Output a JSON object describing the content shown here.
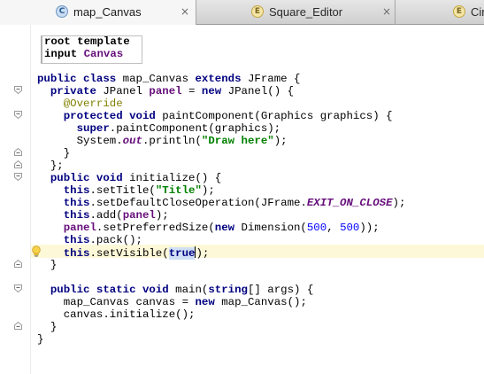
{
  "tabs": [
    {
      "icon": "C",
      "label": "map_Canvas",
      "close": "×",
      "active": true
    },
    {
      "icon": "E",
      "label": "Square_Editor",
      "close": "×",
      "active": false
    },
    {
      "icon": "E",
      "label": "Circ",
      "close": "",
      "active": false
    }
  ],
  "template": {
    "line1_a": "root",
    "line1_b": " template",
    "line2_a": "input",
    "line2_b": " Canvas"
  },
  "code": {
    "l1": {
      "a": "public class",
      "b": " map_Canvas ",
      "c": "extends",
      "d": " JFrame {"
    },
    "l2": {
      "a": "  private",
      "b": " JPanel ",
      "c": "panel",
      "d": " = ",
      "e": "new",
      "f": " JPanel() {"
    },
    "l3": {
      "a": "    @Override"
    },
    "l4": {
      "a": "    protected void",
      "b": " paintComponent(Graphics graphics) {"
    },
    "l5": {
      "a": "      super",
      "b": ".paintComponent(graphics);"
    },
    "l6": {
      "a": "      System.",
      "b": "out",
      "c": ".println(",
      "d": "\"Draw here\"",
      "e": ");"
    },
    "l7": {
      "a": "    }"
    },
    "l8": {
      "a": "  };"
    },
    "l9": {
      "a": "  public void",
      "b": " initialize() {"
    },
    "l10": {
      "a": "    this",
      "b": ".setTitle(",
      "c": "\"Title\"",
      "d": ");"
    },
    "l11": {
      "a": "    this",
      "b": ".setDefaultCloseOperation(JFrame.",
      "c": "EXIT_ON_CLOSE",
      "d": ");"
    },
    "l12": {
      "a": "    this",
      "b": ".add(",
      "c": "panel",
      "d": ");"
    },
    "l13": {
      "a": "    panel",
      "b": ".setPreferredSize(",
      "c": "new",
      "d": " Dimension(",
      "e": "500",
      "f": ", ",
      "g": "500",
      "h": "));"
    },
    "l14": {
      "a": "    this",
      "b": ".pack();"
    },
    "l15": {
      "a": "    this",
      "b": ".setVisible(",
      "c": "true",
      "d": ");"
    },
    "l16": {
      "a": "  }"
    },
    "l17": {
      "a": "  public static void",
      "b": " main(",
      "c": "string",
      "d": "[] args) {"
    },
    "l18": {
      "a": "    map_Canvas canvas = ",
      "b": "new",
      "c": " map_Canvas();"
    },
    "l19": {
      "a": "    canvas.initialize();"
    },
    "l20": {
      "a": "  }"
    },
    "l21": {
      "a": "}"
    }
  },
  "icons": {
    "fold_open": "fold-minus-icon",
    "intention": "lightbulb-icon"
  },
  "colors": {
    "keyword": "#000080",
    "field": "#660e7a",
    "string": "#008000",
    "number": "#0000ff",
    "annotation": "#808000",
    "caret_row": "#fdf8d8"
  }
}
